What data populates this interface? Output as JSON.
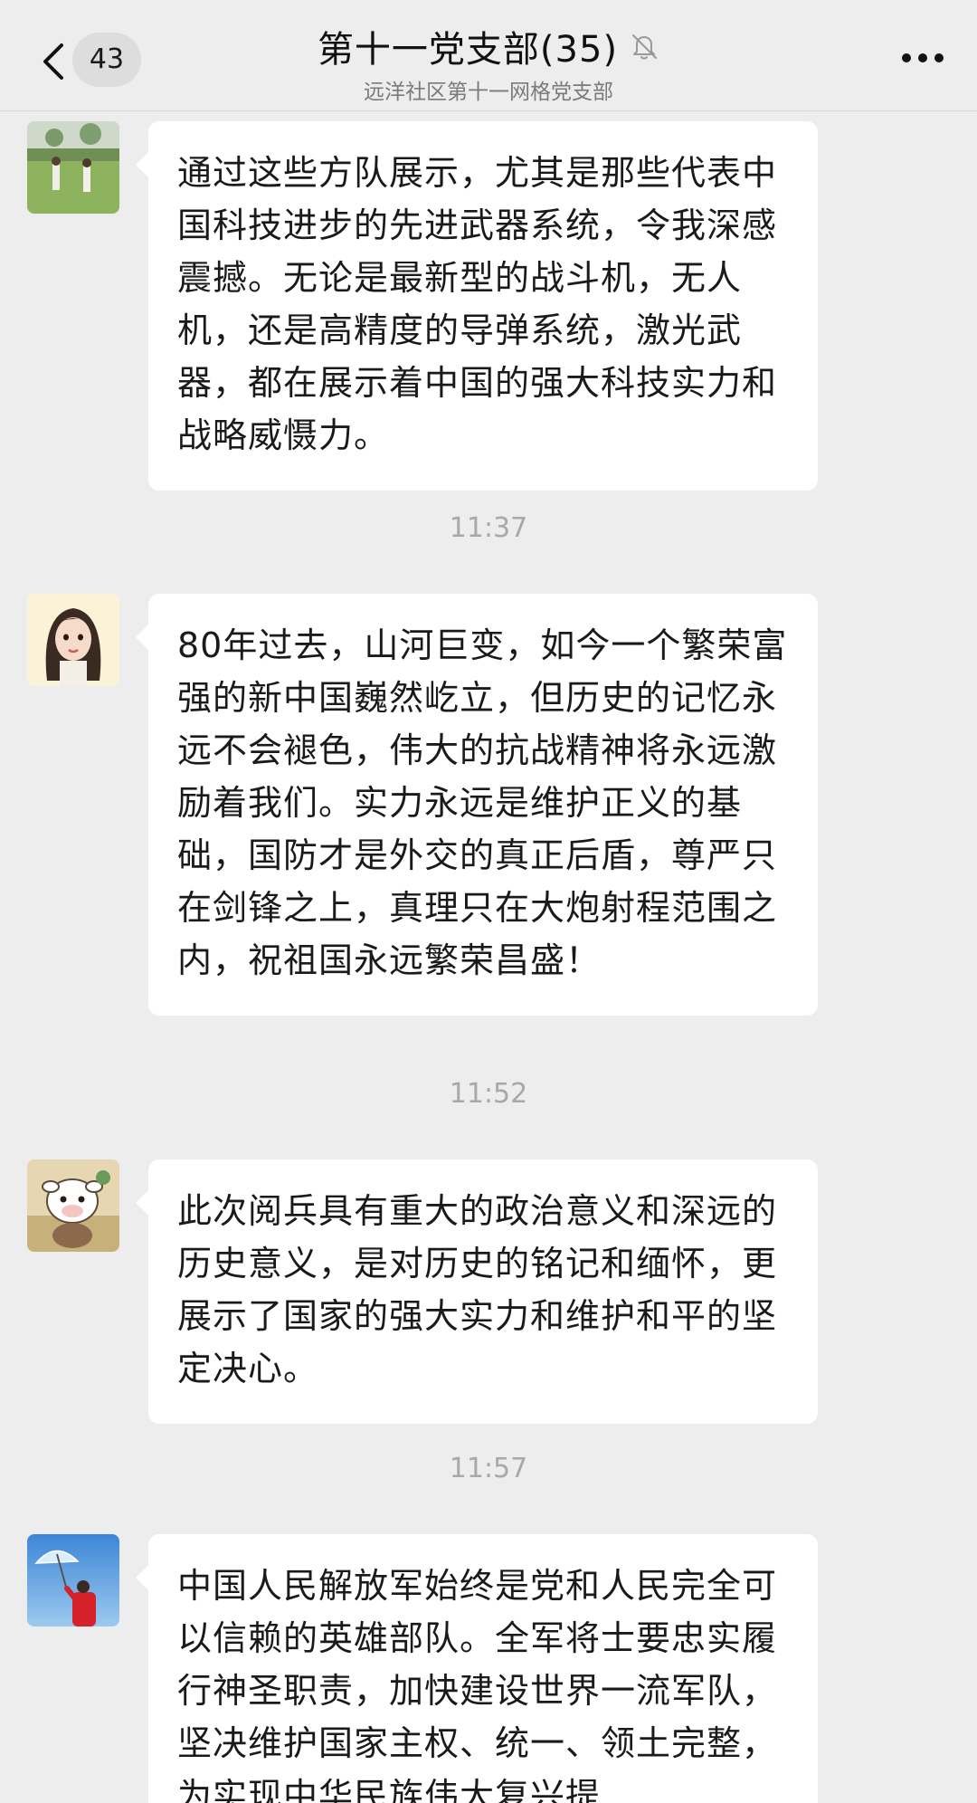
{
  "header": {
    "unread_count": "43",
    "title": "第十一党支部(35)",
    "subtitle": "远洋社区第十一网格党支部"
  },
  "icons": {
    "back": "chevron-left-icon",
    "mute": "bell-muted-icon",
    "more": "more-dots-icon"
  },
  "messages": [
    {
      "avatar": "landscape-photo-avatar",
      "text": "通过这些方队展示，尤其是那些代表中国科技进步的先进武器系统，令我深感震撼。无论是最新型的战斗机，无人机，还是高精度的导弹系统，激光武器，都在展示着中国的强大科技实力和战略威慑力。"
    },
    {
      "avatar": "cartoon-girl-avatar",
      "text": "80年过去，山河巨变，如今一个繁荣富强的新中国巍然屹立，但历史的记忆永远不会褪色，伟大的抗战精神将永远激励着我们。实力永远是维护正义的基础，国防才是外交的真正后盾，尊严只在剑锋之上，真理只在大炮射程范围之内，祝祖国永远繁荣昌盛！"
    },
    {
      "avatar": "cartoon-cow-avatar",
      "text": "此次阅兵具有重大的政治意义和深远的历史意义，是对历史的铭记和缅怀，更展示了国家的强大实力和维护和平的坚定决心。"
    },
    {
      "avatar": "umbrella-photo-avatar",
      "text": "中国人民解放军始终是党和人民完全可以信赖的英雄部队。全军将士要忠实履行神圣职责，加快建设世界一流军队，坚决维护国家主权、统一、领土完整，为实现中华民族伟大复兴提"
    }
  ],
  "timestamps": [
    "11:37",
    "11:52",
    "11:57"
  ],
  "colors": {
    "background": "#ededed",
    "bubble": "#ffffff",
    "timestamp_text": "#a8a8a8"
  }
}
